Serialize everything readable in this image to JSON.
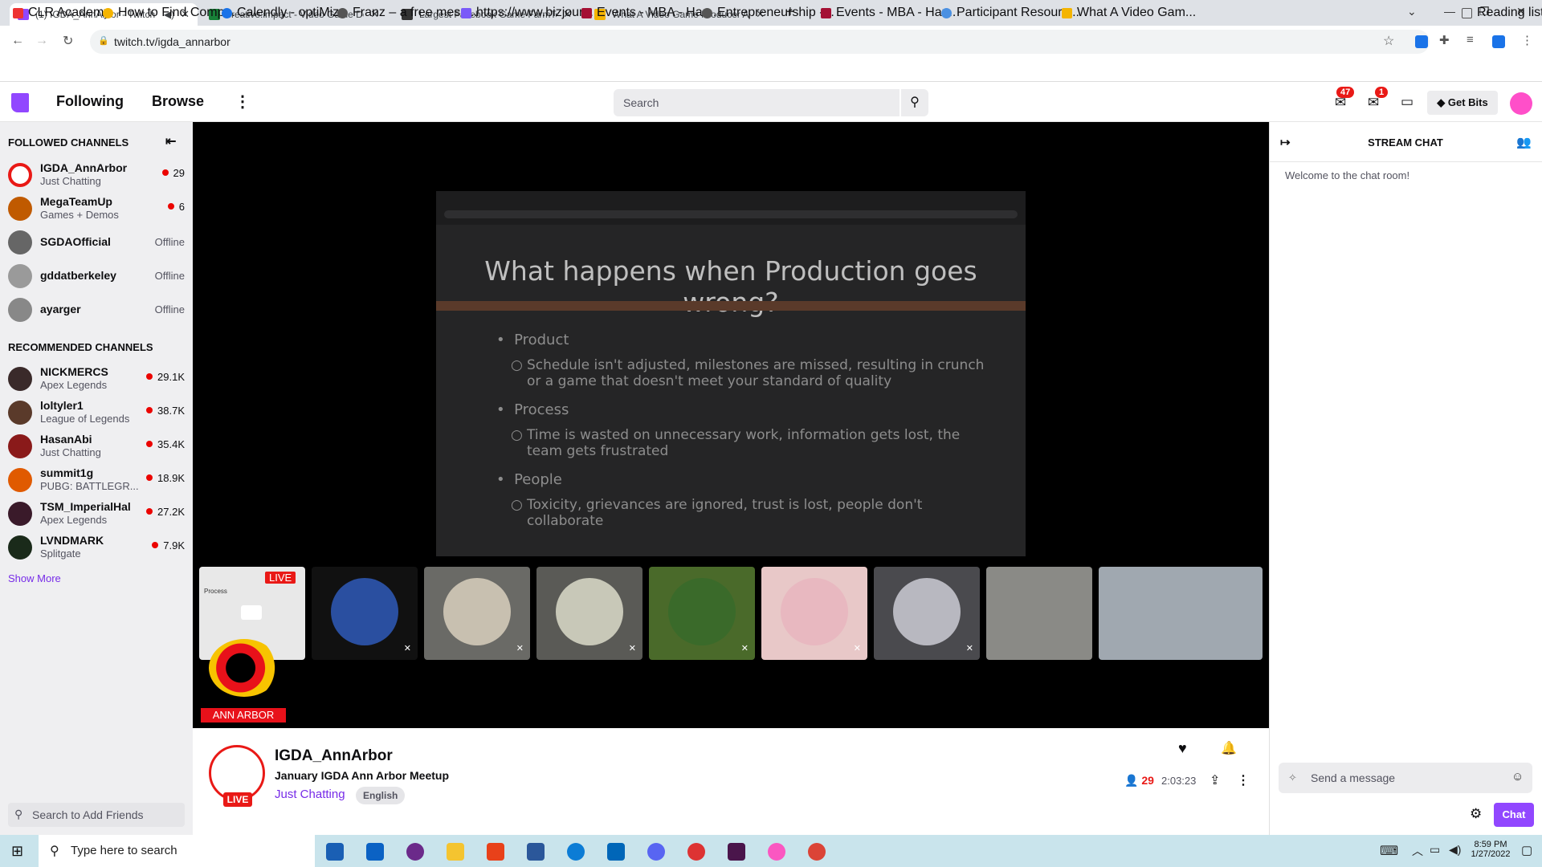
{
  "browser": {
    "tabs": [
      {
        "title": "(1) IGDA_AnnArbor - Twitch",
        "favicon_color": "#9147ff"
      },
      {
        "title": "creative:impact - Video Game De",
        "favicon_color": "#188038"
      },
      {
        "title": "Largest Facebook Game FarmTow",
        "favicon_color": "#333333"
      },
      {
        "title": "What A Video Game Producer Ac",
        "favicon_color": "#f4b400"
      }
    ],
    "url": "twitch.tv/igda_annarbor",
    "bookmarks": [
      "CLR Academy",
      "How to Find Comp...",
      "Calendly - optiMize",
      "Franz – a free mess...",
      "https://www.bizjour...",
      "Events - MBA - Har...",
      "Entrepreneurship -...",
      "Events - MBA - Har...",
      "Participant Resourc...",
      "What A Video Gam..."
    ],
    "reading_list": "Reading list"
  },
  "nav": {
    "following": "Following",
    "browse": "Browse",
    "search_placeholder": "Search",
    "inbox_count": "47",
    "notif_count": "1",
    "get_bits": "Get Bits"
  },
  "sidebar": {
    "followed_header": "FOLLOWED CHANNELS",
    "followed": [
      {
        "name": "IGDA_AnnArbor",
        "game": "Just Chatting",
        "viewers": "29",
        "avatar_color": "#e91916"
      },
      {
        "name": "MegaTeamUp",
        "game": "Games + Demos",
        "viewers": "6",
        "avatar_color": "#c05a00"
      },
      {
        "name": "SGDAOfficial",
        "status": "Offline",
        "avatar_color": "#666666"
      },
      {
        "name": "gddatberkeley",
        "status": "Offline",
        "avatar_color": "#9a9a9a"
      },
      {
        "name": "ayarger",
        "status": "Offline",
        "avatar_color": "#888888"
      }
    ],
    "recommended_header": "RECOMMENDED CHANNELS",
    "recommended": [
      {
        "name": "NICKMERCS",
        "game": "Apex Legends",
        "viewers": "29.1K",
        "avatar_color": "#3a2a2a"
      },
      {
        "name": "loltyler1",
        "game": "League of Legends",
        "viewers": "38.7K",
        "avatar_color": "#5a3a2a"
      },
      {
        "name": "HasanAbi",
        "game": "Just Chatting",
        "viewers": "35.4K",
        "avatar_color": "#8a1a1a"
      },
      {
        "name": "summit1g",
        "game": "PUBG: BATTLEGR...",
        "viewers": "18.9K",
        "avatar_color": "#e05a00"
      },
      {
        "name": "TSM_ImperialHal",
        "game": "Apex Legends",
        "viewers": "27.2K",
        "avatar_color": "#3a1a2a"
      },
      {
        "name": "LVNDMARK",
        "game": "Splitgate",
        "viewers": "7.9K",
        "avatar_color": "#1a2a1a"
      }
    ],
    "show_more": "Show More",
    "friend_search": "Search to Add Friends"
  },
  "video": {
    "slide_title": "What happens when Production goes wrong?",
    "bullets": [
      {
        "head": "Product",
        "text": "Schedule isn't adjusted, milestones are missed, resulting in crunch or a game that doesn't meet your standard of quality"
      },
      {
        "head": "Process",
        "text": "Time is wasted on unnecessary work, information gets lost, the team gets frustrated"
      },
      {
        "head": "People",
        "text": "Toxicity, grievances are ignored, trust is lost, people don't collaborate"
      }
    ],
    "live_tile_label": "LIVE",
    "tile_mini_title": "Process",
    "org_label": "ANN ARBOR",
    "participant_colors": [
      "#2a4fa0",
      "#c8c0b0",
      "#c8c8b8",
      "#3a6a2a",
      "#e8b8c0",
      "#b8b8c0"
    ]
  },
  "stream": {
    "channel": "IGDA_AnnArbor",
    "title": "January IGDA Ann Arbor Meetup",
    "category": "Just Chatting",
    "language": "English",
    "live": "LIVE",
    "viewers": "29",
    "uptime": "2:03:23"
  },
  "chat": {
    "header": "STREAM CHAT",
    "welcome": "Welcome to the chat room!",
    "placeholder": "Send a message",
    "button": "Chat"
  },
  "taskbar": {
    "search": "Type here to search",
    "time": "8:59 PM",
    "date": "1/27/2022"
  },
  "colors": {
    "twitch_purple": "#9147ff",
    "live_red": "#e91916"
  }
}
